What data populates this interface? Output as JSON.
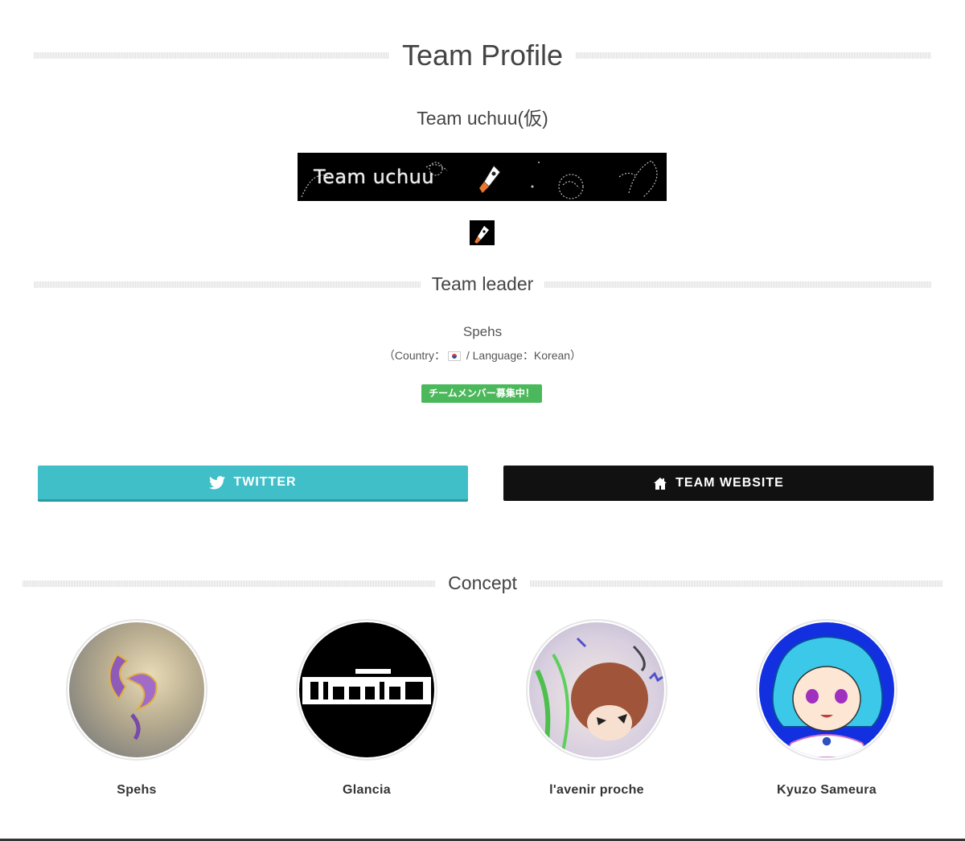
{
  "section_title": "Team Profile",
  "team_name": "Team uchuu(仮)",
  "banner": {
    "text": "Team uchuu"
  },
  "leader": {
    "heading": "Team leader",
    "name": "Spehs",
    "country_label": "（Country：",
    "language_label": " / Language：Korean）",
    "recruit_badge": "チームメンバー募集中！"
  },
  "buttons": {
    "twitter": {
      "label": "TWITTER",
      "icon": "twitter-icon"
    },
    "website": {
      "label": "TEAM WEBSITE",
      "icon": "home-icon"
    }
  },
  "concept": {
    "heading": "Concept",
    "members": [
      {
        "name": "Spehs"
      },
      {
        "name": "Glancia"
      },
      {
        "name": "l'avenir proche"
      },
      {
        "name": "Kyuzo Sameura"
      }
    ]
  },
  "colors": {
    "twitter_button": "#40bfc9",
    "website_button": "#111111",
    "recruit_badge": "#4cb85c"
  }
}
